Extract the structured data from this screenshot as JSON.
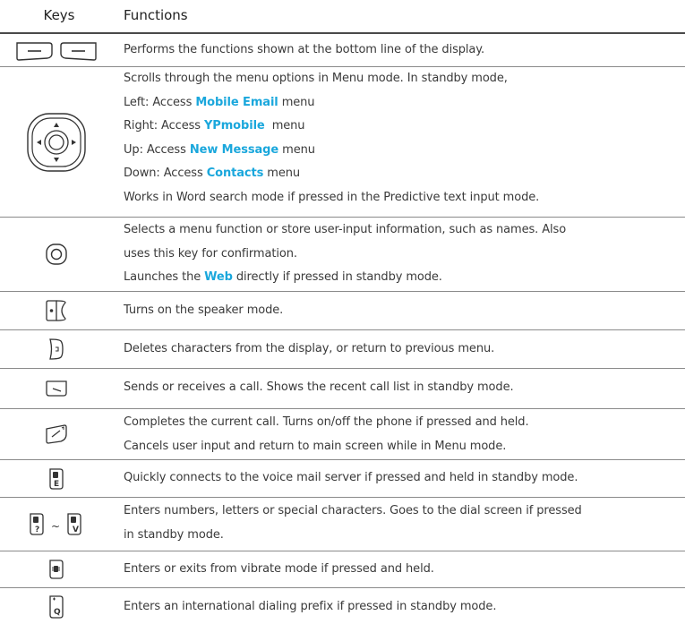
{
  "header": {
    "keys_label": "Keys",
    "functions_label": "Functions"
  },
  "rows": [
    {
      "key_icon": "soft-keys-icon",
      "lines": [
        {
          "parts": [
            "Performs the functions shown at the bottom line of the display."
          ]
        }
      ]
    },
    {
      "key_icon": "navigation-key-icon",
      "lines": [
        {
          "parts": [
            "Scrolls through the menu options in Menu mode. In standby mode,"
          ]
        },
        {
          "parts": [
            "Left: Access ",
            "Mobile Email",
            " menu"
          ]
        },
        {
          "parts": [
            "Right: Access ",
            "YPmobile",
            "  menu"
          ]
        },
        {
          "parts": [
            "Up: Access ",
            "New Message",
            " menu"
          ]
        },
        {
          "parts": [
            "Down: Access ",
            "Contacts",
            " menu"
          ]
        },
        {
          "parts": [
            "Works in Word search mode if pressed in the Predictive text input mode."
          ]
        }
      ]
    },
    {
      "key_icon": "confirm-key-icon",
      "lines": [
        {
          "parts": [
            "Selects a menu function or store user-input information, such as names. Also"
          ]
        },
        {
          "parts": [
            "uses this key for confirmation."
          ]
        },
        {
          "parts": [
            "Launches the ",
            "Web",
            " directly if pressed in standby mode."
          ]
        }
      ]
    },
    {
      "key_icon": "speaker-key-icon",
      "lines": [
        {
          "parts": [
            "Turns on the speaker mode."
          ]
        }
      ]
    },
    {
      "key_icon": "clear-key-icon",
      "lines": [
        {
          "parts": [
            "Deletes characters from the display, or return to previous menu."
          ]
        }
      ]
    },
    {
      "key_icon": "send-key-icon",
      "lines": [
        {
          "parts": [
            "Sends or receives a call. Shows the recent call list in standby mode."
          ]
        }
      ]
    },
    {
      "key_icon": "end-key-icon",
      "lines": [
        {
          "parts": [
            "Completes the current call. Turns on/off the phone if pressed and held."
          ]
        },
        {
          "parts": [
            "Cancels user input and return to main screen while in Menu mode."
          ]
        }
      ]
    },
    {
      "key_icon": "voicemail-key-icon",
      "key_char": "E",
      "lines": [
        {
          "parts": [
            "Quickly connects to the voice mail server if pressed and held in standby mode."
          ]
        }
      ]
    },
    {
      "key_icon": "alphanumeric-keys-icon",
      "key_char_start": "?",
      "key_tilde": "~",
      "key_char_end": "V",
      "lines": [
        {
          "parts": [
            "Enters numbers, letters or special characters. Goes to the dial screen if pressed"
          ]
        },
        {
          "parts": [
            "in standby mode."
          ]
        }
      ]
    },
    {
      "key_icon": "vibrate-key-icon",
      "lines": [
        {
          "parts": [
            "Enters or exits from vibrate mode if pressed and held."
          ]
        }
      ]
    },
    {
      "key_icon": "international-prefix-key-icon",
      "key_char": "Q",
      "lines": [
        {
          "parts": [
            "Enters an international dialing prefix if pressed in standby mode."
          ]
        }
      ]
    }
  ]
}
